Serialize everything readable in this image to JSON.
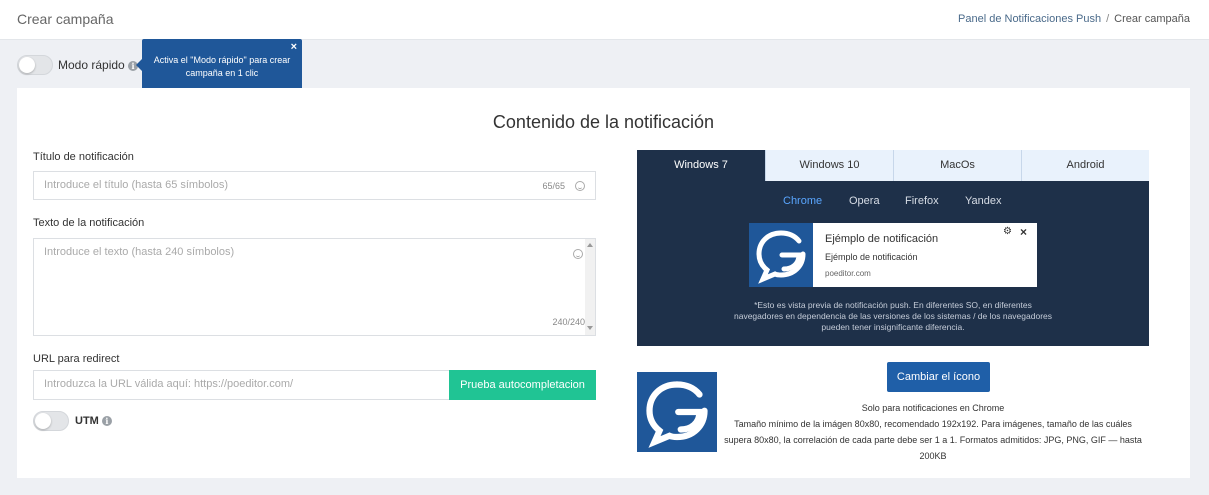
{
  "header": {
    "title": "Crear campaña",
    "breadcrumb": {
      "parent": "Panel de Notificaciones Push",
      "separator": "/",
      "current": "Crear campaña"
    }
  },
  "quick_mode": {
    "label": "Modo rápido",
    "tooltip": "Activa el \"Modo rápido\" para crear campaña en 1 clic",
    "tooltip_close": "×"
  },
  "section": {
    "title": "Contenido de la notificación"
  },
  "form": {
    "title_label": "Título de notificación",
    "title_placeholder": "Introduce el título (hasta 65 símbolos)",
    "title_counter": "65/65",
    "text_label": "Texto de la notificación",
    "text_placeholder": "Introduce el texto (hasta 240 símbolos)",
    "text_counter": "240/240",
    "url_label": "URL para redirect",
    "url_placeholder": "Introduzca la URL válida aquí: https://poeditor.com/",
    "autocomplete_button": "Prueba autocompletacion",
    "utm_label": "UTM"
  },
  "preview": {
    "os_tabs": [
      "Windows 7",
      "Windows 10",
      "MacOs",
      "Android"
    ],
    "active_os": "Windows 7",
    "browsers": [
      "Chrome",
      "Opera",
      "Firefox",
      "Yandex"
    ],
    "active_browser": "Chrome",
    "notification": {
      "title": "Ejémplo de notificación",
      "body": "Ejémplo de notificación",
      "domain": "poeditor.com"
    },
    "disclaimer": "*Esto es vista previa de notificación push. En diferentes SO, en diferentes navegadores en dependencia de las versiones de los sistemas / de los navegadores pueden tener insignificante diferencia."
  },
  "icon_settings": {
    "change_button": "Cambiar el ícono",
    "line1": "Solo para notificaciones en Chrome",
    "line2": "Tamaño mínimo de la imágen 80x80, recomendado 192x192. Para imágenes, tamaño de las cuáles supera 80x80, la correlación  de cada parte debe ser 1 a 1. Formatos admitidos: JPG, PNG, GIF — hasta 200KB"
  },
  "colors": {
    "brand_blue": "#1f5799",
    "preview_bg": "#1e3049",
    "green": "#20c494",
    "active_browser": "#5aa6ff"
  }
}
